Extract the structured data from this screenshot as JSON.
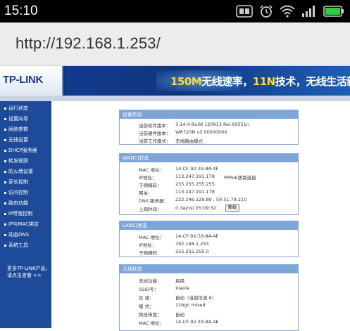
{
  "status_bar": {
    "time": "15:10",
    "icons": [
      "sim-icon",
      "alarm-icon",
      "wifi-icon",
      "signal-icon",
      "battery-icon"
    ]
  },
  "browser": {
    "url": "http://192.168.1.253/"
  },
  "banner": {
    "logo": "TP-LINK",
    "slogan_highlight": "150M",
    "slogan_part1": "无线速率，",
    "slogan_highlight2": "11N",
    "slogan_part2": "技术，无线生活新选择"
  },
  "sidebar": {
    "items": [
      "运行状态",
      "设置向导",
      "网络参数",
      "无线设置",
      "DHCP服务器",
      "转发规则",
      "防火墙设置",
      "家长控制",
      "访问控制",
      "路由功能",
      "IP带宽控制",
      "IP与MAC绑定",
      "动态DNS",
      "系统工具"
    ],
    "more_line1": "更多TP-LINK产品，",
    "more_line2": "请点击查看 >>"
  },
  "panels": {
    "device": {
      "title": "设备信息",
      "rows": [
        {
          "label": "当前软件版本：",
          "value": "3.14.4 Build 120913 Rel.60551n"
        },
        {
          "label": "当前硬件版本：",
          "value": "WR720N v3 00000000"
        },
        {
          "label": "当前工作模式：",
          "value": "无线路由模式"
        }
      ]
    },
    "wan": {
      "title": "WAN口状态",
      "rows": [
        {
          "label": "MAC 地址：",
          "value": "14-CF-92-33-8A-4F"
        },
        {
          "label": "IP地址：",
          "value": "113.247.191.178",
          "extra": "PPPoE按需连接"
        },
        {
          "label": "子网掩码：",
          "value": "255.255.255.255"
        },
        {
          "label": "网关：",
          "value": "113.247.191.178"
        },
        {
          "label": "DNS 服务器：",
          "value": "222.246.129.80 , 59.51.78.210"
        },
        {
          "label": "上网时间：",
          "value": "0 day(s) 05:09:32"
        }
      ],
      "disconnect_label": "断线"
    },
    "lan": {
      "title": "LAN口状态",
      "rows": [
        {
          "label": "MAC 地址：",
          "value": "14-CF-92-33-8A-4E"
        },
        {
          "label": "IP地址：",
          "value": "192.168.1.253"
        },
        {
          "label": "子网掩码：",
          "value": "255.255.255.0"
        }
      ]
    },
    "wireless": {
      "title": "无线状态",
      "rows": [
        {
          "label": "无线功能：",
          "value": "启用"
        },
        {
          "label": "SSID号：",
          "value": "Xiaole"
        },
        {
          "label": "信 道：",
          "value": "自动（当前信道 6）"
        },
        {
          "label": "模 式：",
          "value": "11bgn mixed"
        },
        {
          "label": "频段带宽：",
          "value": "自动"
        },
        {
          "label": "MAC 地址：",
          "value": "14-CF-92-33-8A-4E"
        }
      ]
    }
  }
}
